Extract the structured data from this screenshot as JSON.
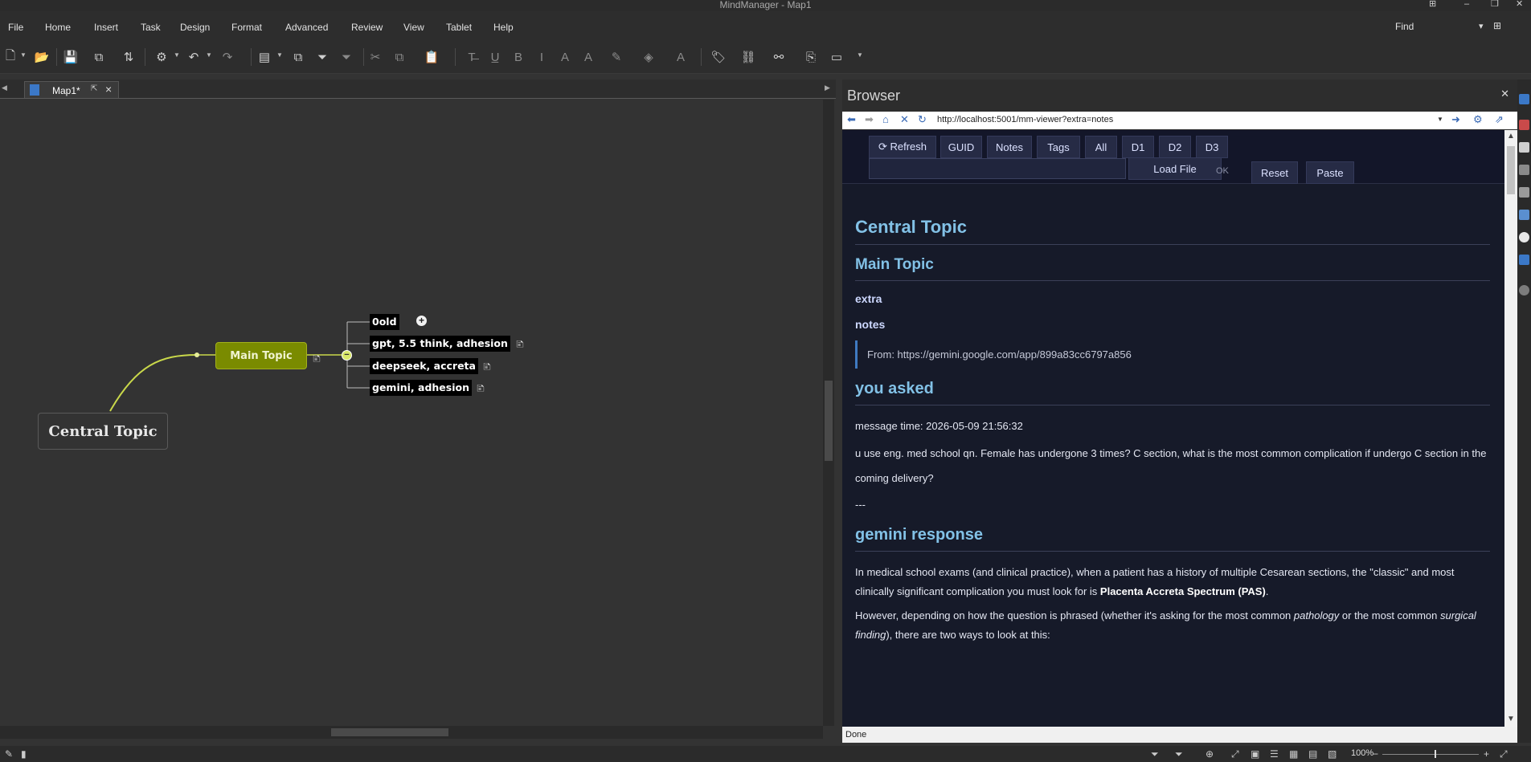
{
  "window": {
    "title": "MindManager - Map1"
  },
  "menu": {
    "items": [
      "File",
      "Home",
      "Insert",
      "Task",
      "Design",
      "Format",
      "Advanced",
      "Review",
      "View",
      "Tablet",
      "Help"
    ],
    "find_label": "Find"
  },
  "tabs": {
    "map_tab": "Map1*"
  },
  "map": {
    "central_topic": "Central Topic",
    "main_topic": "Main Topic",
    "subtopics": [
      "0old",
      "gpt, 5.5 think, adhesion",
      "deepseek, accreta",
      "gemini, adhesion"
    ],
    "branch_color": "#c9d84a",
    "main_topic_color": "#7a8b00"
  },
  "browser": {
    "title": "Browser",
    "url": "http://localhost:5001/mm-viewer?extra=notes",
    "status": "Done",
    "toolbar": {
      "refresh": "⟳ Refresh",
      "guid": "GUID",
      "notes": "Notes",
      "tags": "Tags",
      "all": "All",
      "d1": "D1",
      "d2": "D2",
      "d3": "D3",
      "load_file": "Load File",
      "ok": "OK",
      "reset": "Reset",
      "paste": "Paste"
    },
    "content": {
      "h_central": "Central Topic",
      "h_main": "Main Topic",
      "h_extra": "extra",
      "h_notes": "notes",
      "from_line": "From: https://gemini.google.com/app/899a83cc6797a856",
      "h_you_asked": "you asked",
      "message_time": "message time: 2026-05-09 21:56:32",
      "question": "u use eng. med school qn. Female has undergone 3 times? C section, what is the most common complication if undergo C section in the coming delivery?",
      "separator": "---",
      "h_gemini": "gemini response",
      "p1_start": "In medical school exams (and clinical practice), when a patient has a history of multiple Cesarean sections, the \"classic\" and most clinically significant complication you must look for is ",
      "p1_bold": "Placenta Accreta Spectrum (PAS)",
      "p1_end": ".",
      "p2_start": "However, depending on how the question is phrased (whether it's asking for the most common ",
      "p2_em1": "pathology",
      "p2_mid": " or the most common ",
      "p2_em2": "surgical finding",
      "p2_end": "), there are two ways to look at this:"
    }
  },
  "statusbar": {
    "zoom": "100%"
  }
}
